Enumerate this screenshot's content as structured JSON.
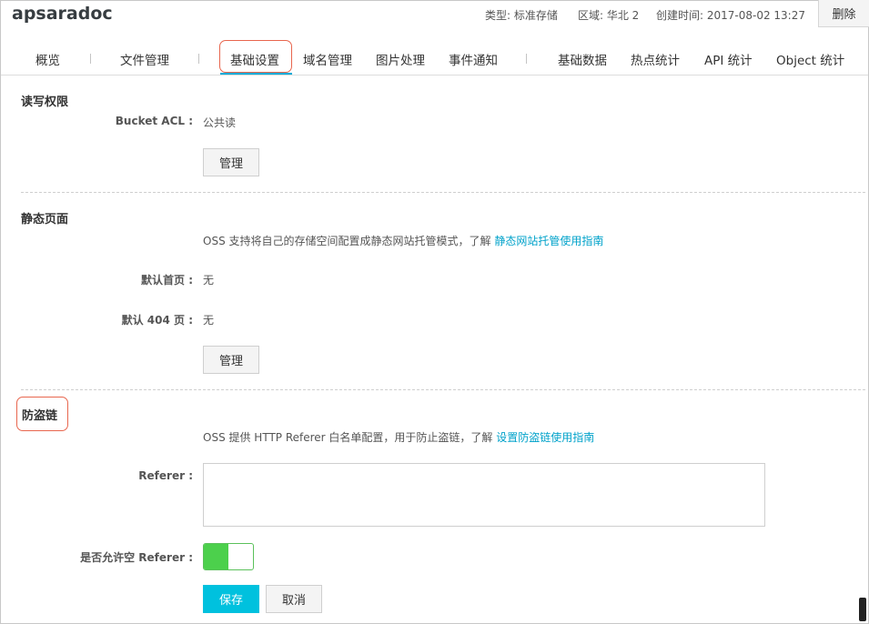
{
  "header": {
    "title": "apsaradoc",
    "type": "类型: 标准存储",
    "region": "区域: 华北 2",
    "created": "创建时间: 2017-08-02 13:27",
    "delete_label": "删除"
  },
  "tabs": [
    {
      "label": "概览"
    },
    {
      "label": "文件管理"
    },
    {
      "label": "基础设置",
      "active": true
    },
    {
      "label": "域名管理"
    },
    {
      "label": "图片处理"
    },
    {
      "label": "事件通知"
    },
    {
      "label": "基础数据"
    },
    {
      "label": "热点统计"
    },
    {
      "label": "API 统计"
    },
    {
      "label": "Object 统计"
    }
  ],
  "acl_section": {
    "title": "读写权限",
    "acl_label": "Bucket ACL :",
    "acl_value": "公共读",
    "manage_label": "管理"
  },
  "static_section": {
    "title": "静态页面",
    "desc": "OSS 支持将自己的存储空间配置成静态网站托管模式，了解 ",
    "link": "静态网站托管使用指南",
    "index_label": "默认首页 :",
    "index_value": "无",
    "notfound_label": "默认 404 页 :",
    "notfound_value": "无",
    "manage_label": "管理"
  },
  "hotlink_section": {
    "title": "防盗链",
    "desc": "OSS 提供 HTTP Referer 白名单配置，用于防止盗链，了解 ",
    "link": "设置防盗链使用指南",
    "referer_label": "Referer :",
    "referer_value": "",
    "allow_empty_label": "是否允许空 Referer :",
    "allow_empty": true,
    "save_label": "保存",
    "cancel_label": "取消"
  },
  "colors": {
    "accent": "#00c1de",
    "link": "#00a2ca",
    "toggle_on": "#4cd04c",
    "highlight": "#e8664e"
  }
}
